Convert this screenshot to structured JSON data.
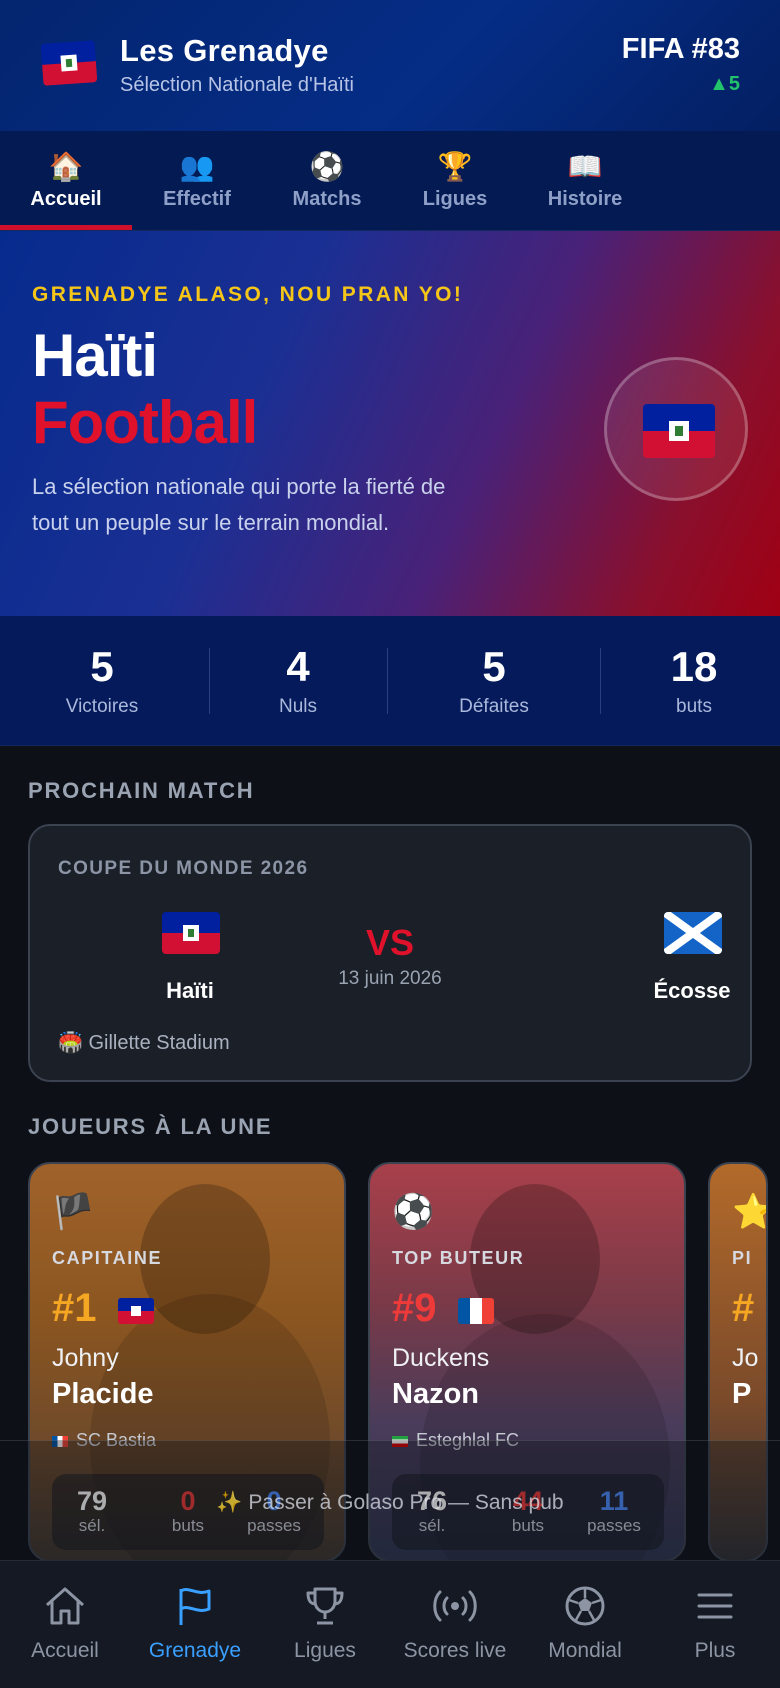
{
  "header": {
    "title": "Les Grenadye",
    "subtitle": "Sélection Nationale d'Haïti",
    "fifa_rank": "FIFA #83",
    "rank_change": "▲5"
  },
  "tabs": [
    {
      "icon": "🏠",
      "label": "Accueil",
      "active": true
    },
    {
      "icon": "👥",
      "label": "Effectif"
    },
    {
      "icon": "⚽",
      "label": "Matchs"
    },
    {
      "icon": "🏆",
      "label": "Ligues"
    },
    {
      "icon": "📖",
      "label": "Histoire"
    }
  ],
  "hero": {
    "tagline": "GRENADYE ALASO, NOU PRAN YO!",
    "title_line1": "Haïti",
    "title_line2": "Football",
    "description": "La sélection nationale qui porte la fierté de tout un peuple sur le terrain mondial."
  },
  "stats": [
    {
      "value": "5",
      "label": "Victoires"
    },
    {
      "value": "4",
      "label": "Nuls"
    },
    {
      "value": "5",
      "label": "Défaites"
    },
    {
      "value": "18",
      "label": "buts"
    }
  ],
  "next_match": {
    "section_title": "PROCHAIN MATCH",
    "competition": "COUPE DU MONDE 2026",
    "home_team": "Haïti",
    "away_team": "Écosse",
    "vs": "VS",
    "date": "13 juin 2026",
    "venue": "🏟️ Gillette Stadium"
  },
  "featured_players": {
    "section_title": "JOUEURS À LA UNE",
    "players": [
      {
        "icon": "🏴",
        "role": "CAPITAINE",
        "number": "#1",
        "first_name": "Johny",
        "last_name": "Placide",
        "club": "SC Bastia",
        "selections": "79",
        "goals": "0",
        "assists": "0"
      },
      {
        "icon": "⚽",
        "role": "TOP BUTEUR",
        "number": "#9",
        "first_name": "Duckens",
        "last_name": "Nazon",
        "club": "Esteghlal FC",
        "selections": "76",
        "goals": "44",
        "assists": "11"
      },
      {
        "icon": "⭐",
        "role": "PI",
        "number": "#",
        "first_name": "Jo",
        "last_name": "P"
      }
    ],
    "stat_labels": {
      "selections": "sél.",
      "goals": "buts",
      "assists": "passes"
    }
  },
  "promo": {
    "text": "✨ Passer à Golaso Pro — Sans pub"
  },
  "bottom_nav": [
    {
      "label": "Accueil",
      "icon": "home-icon"
    },
    {
      "label": "Grenadye",
      "icon": "flag-icon",
      "active": true
    },
    {
      "label": "Ligues",
      "icon": "trophy-icon"
    },
    {
      "label": "Scores live",
      "icon": "broadcast-icon"
    },
    {
      "label": "Mondial",
      "icon": "soccer-ball-icon"
    },
    {
      "label": "Plus",
      "icon": "menu-icon"
    }
  ],
  "colors": {
    "haiti_blue": "#00209f",
    "haiti_red": "#d21034",
    "accent_gold": "#f5c518",
    "active_blue": "#3aa0ff",
    "rank_up_green": "#22c36a"
  }
}
